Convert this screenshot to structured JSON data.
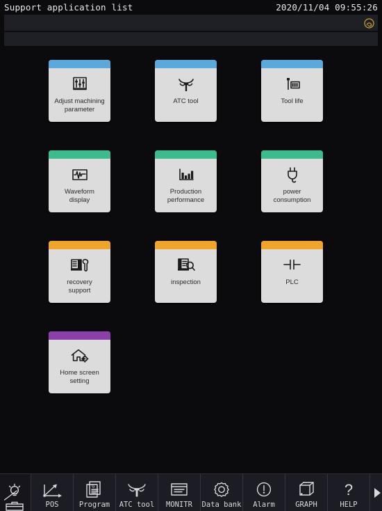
{
  "header": {
    "title": "Support application list",
    "datetime": "2020/11/04 09:55:26",
    "brand_icon": "swirl-logo-icon",
    "brand_color": "#caa031"
  },
  "colors": {
    "background": "#0b0b0d",
    "tile_face": "#dcdcdc",
    "accent_blue": "#5aa9dc",
    "accent_green": "#3cbc8d",
    "accent_orange": "#f0a42a",
    "accent_purple": "#8b3fa8",
    "toolbar_bg": "#1c1c24",
    "text_light": "#d9d9dd"
  },
  "tiles": [
    {
      "label": "Adjust machining\nparameter",
      "accent": "#5aa9dc",
      "icon": "sliders-icon"
    },
    {
      "label": "ATC tool",
      "accent": "#5aa9dc",
      "icon": "atc-tool-icon"
    },
    {
      "label": "Tool life",
      "accent": "#5aa9dc",
      "icon": "tool-life-icon"
    },
    {
      "label": "Waveform\ndisplay",
      "accent": "#3cbc8d",
      "icon": "waveform-icon"
    },
    {
      "label": "Production\nperformance",
      "accent": "#3cbc8d",
      "icon": "bar-chart-icon"
    },
    {
      "label": "power\nconsumption",
      "accent": "#3cbc8d",
      "icon": "power-plug-icon"
    },
    {
      "label": "recovery\nsupport",
      "accent": "#f0a42a",
      "icon": "recovery-wrench-icon"
    },
    {
      "label": "inspection",
      "accent": "#f0a42a",
      "icon": "inspection-magnifier-icon"
    },
    {
      "label": "PLC",
      "accent": "#f0a42a",
      "icon": "plc-contact-icon"
    },
    {
      "label": "Home screen\nsetting",
      "accent": "#8b3fa8",
      "icon": "home-gear-icon"
    }
  ],
  "toolbar": [
    {
      "label": "",
      "icon": "support-toolbox-icon",
      "active": true
    },
    {
      "label": "POS",
      "icon": "position-axes-icon",
      "active": false
    },
    {
      "label": "Program",
      "icon": "program-file-icon",
      "active": false
    },
    {
      "label": "ATC tool",
      "icon": "atc-tool-icon",
      "active": false
    },
    {
      "label": "MONITR",
      "icon": "monitor-icon",
      "active": false
    },
    {
      "label": "Data bank",
      "icon": "gear-icon",
      "active": false
    },
    {
      "label": "Alarm",
      "icon": "alarm-exclamation-icon",
      "active": false
    },
    {
      "label": "GRAPH",
      "icon": "cube-icon",
      "active": false
    },
    {
      "label": "HELP",
      "icon": "question-mark-icon",
      "active": false
    }
  ],
  "toolbar_next": {
    "label": "▶",
    "icon": "next-page-arrow-icon"
  }
}
